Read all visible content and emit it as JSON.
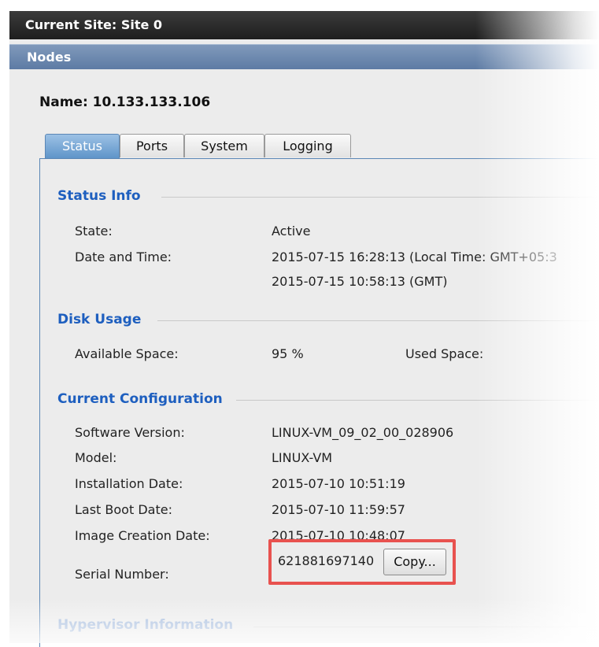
{
  "header": {
    "current_site": "Current Site:  Site 0"
  },
  "panel": {
    "title": "Nodes"
  },
  "node": {
    "name_label": "Name: 10.133.133.106"
  },
  "tabs": [
    {
      "label": "Status",
      "active": true
    },
    {
      "label": "Ports",
      "active": false
    },
    {
      "label": "System",
      "active": false
    },
    {
      "label": "Logging",
      "active": false
    }
  ],
  "status_info": {
    "title": "Status Info",
    "state_label": "State:",
    "state_value": "Active",
    "datetime_label": "Date and Time:",
    "datetime_local": "2015-07-15 16:28:13 (Local Time:  GMT+05:3",
    "datetime_gmt": "2015-07-15 10:58:13 (GMT)"
  },
  "disk_usage": {
    "title": "Disk Usage",
    "available_label": "Available Space:",
    "available_value": "95 %",
    "used_label": "Used Space:"
  },
  "current_configuration": {
    "title": "Current Configuration",
    "rows": [
      {
        "label": "Software Version:",
        "value": "LINUX-VM_09_02_00_028906"
      },
      {
        "label": "Model:",
        "value": "LINUX-VM"
      },
      {
        "label": "Installation Date:",
        "value": "2015-07-10 10:51:19"
      },
      {
        "label": "Last Boot Date:",
        "value": "2015-07-10 11:59:57"
      },
      {
        "label": "Image Creation Date:",
        "value": "2015-07-10 10:48:07"
      }
    ],
    "serial_label": "Serial Number:",
    "serial_value": "621881697140",
    "copy_button": "Copy..."
  },
  "hypervisor": {
    "title": "Hypervisor Information"
  },
  "colors": {
    "section_title": "#1e5fbf",
    "active_tab": "#5d93c8",
    "highlight": "#e8524f",
    "site_bar": "#2a2a2a",
    "nodes_bar": "#6a87ae"
  }
}
